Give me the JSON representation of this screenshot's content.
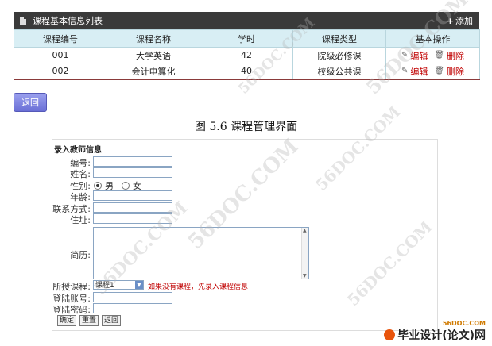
{
  "course_list": {
    "title": "课程基本信息列表",
    "add_label": "添加",
    "columns": [
      "课程编号",
      "课程名称",
      "学时",
      "课程类型",
      "基本操作"
    ],
    "rows": [
      {
        "id": "001",
        "name": "大学英语",
        "hours": "42",
        "type": "院级必修课",
        "edit": "编辑",
        "delete": "删除"
      },
      {
        "id": "002",
        "name": "会计电算化",
        "hours": "40",
        "type": "校级公共课",
        "edit": "编辑",
        "delete": "删除"
      }
    ]
  },
  "back_button": "返回",
  "caption": "图 5.6 课程管理界面",
  "teacher_form": {
    "title": "录入教师信息",
    "labels": {
      "id": "编号:",
      "name": "姓名:",
      "gender": "性别:",
      "age": "年龄:",
      "contact": "联系方式:",
      "address": "住址:",
      "resume": "简历:",
      "course": "所授课程:",
      "account": "登陆账号:",
      "password": "登陆密码:"
    },
    "gender_options": [
      "男",
      "女"
    ],
    "gender_selected": "男",
    "course_selected": "课程1",
    "course_hint": "如果没有课程，先录入课程信息",
    "buttons": {
      "ok": "确定",
      "reset": "重置",
      "back": "返回"
    }
  },
  "watermarks": [
    "56DOC.COM",
    "56DOC.COM",
    "56DOC.COM",
    "56DOC.COM",
    "56DOC.COM",
    "56DOC.COM"
  ],
  "footer": {
    "site": "56DOC.COM",
    "brand": "毕业设计(论文)网"
  }
}
